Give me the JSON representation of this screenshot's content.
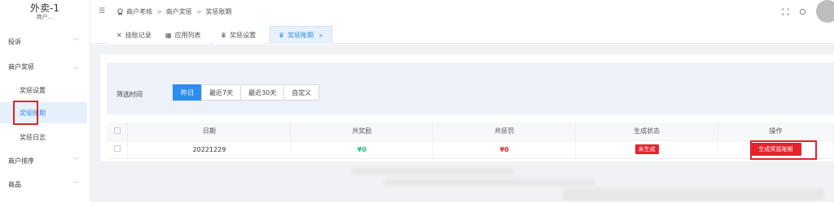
{
  "brand": {
    "title": "外卖-1",
    "subtitle": "商户..."
  },
  "sidebar": {
    "groups": [
      {
        "label": "投诉",
        "chevron": "﹀"
      },
      {
        "label": "商户奖惩",
        "chevron": "︿"
      },
      {
        "label": "商户排序",
        "chevron": "﹀"
      },
      {
        "label": "商品",
        "chevron": "﹀"
      }
    ],
    "sub_items": [
      {
        "label": "奖惩设置"
      },
      {
        "label": "奖惩账期"
      },
      {
        "label": "奖惩日志"
      }
    ]
  },
  "header": {
    "collapse_icon": "☰",
    "breadcrumb": [
      "商户考核",
      "商户奖惩",
      "奖惩账期"
    ],
    "separator": ">"
  },
  "tabs": [
    {
      "label": "挂账记录",
      "icon": "✕"
    },
    {
      "label": "应用列表",
      "icon": "▦"
    },
    {
      "label": "奖惩设置",
      "icon": "♛"
    },
    {
      "label": "奖惩账期",
      "icon": "♛",
      "close": "×"
    }
  ],
  "filter": {
    "label": "筛选时间",
    "options": [
      "昨日",
      "最近7天",
      "最近30天",
      "自定义"
    ],
    "selected": "昨日"
  },
  "table": {
    "headers": [
      "日期",
      "共奖励",
      "共惩罚",
      "生成状态",
      "操作"
    ],
    "rows": [
      {
        "date": "20221229",
        "reward": "¥0",
        "penalty": "¥0",
        "status": "未生成",
        "action": "生成奖惩账期"
      }
    ]
  },
  "colors": {
    "accent": "#2d8cf0",
    "danger": "#e5232d",
    "success": "#19be6b"
  }
}
